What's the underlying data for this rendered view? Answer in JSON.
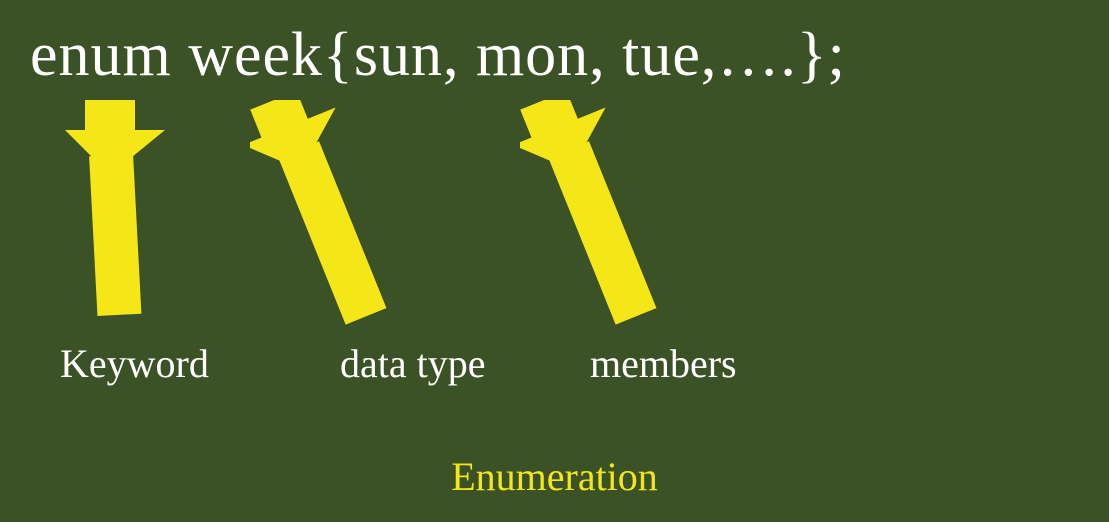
{
  "code": {
    "full": "enum week{sun, mon, tue,….};"
  },
  "annotations": {
    "keyword": "Keyword",
    "datatype": "data type",
    "members": "members"
  },
  "title": "Enumeration",
  "colors": {
    "accent": "#f5e617",
    "bg": "#3a5225",
    "text": "#ffffff"
  }
}
